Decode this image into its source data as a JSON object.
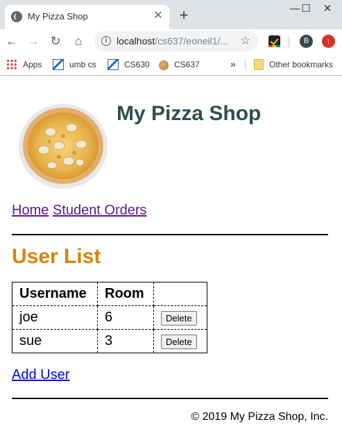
{
  "browser": {
    "tab_title": "My Pizza Shop",
    "tab_close": "✕",
    "new_tab": "+",
    "window_controls": {
      "minimize": "—",
      "maximize": "☐",
      "close": "✕"
    },
    "url_host": "localhost",
    "url_path": "/cs637/eoneil1/...",
    "avatar_letter": "B",
    "bookmarks": [
      "Apps",
      "umb cs",
      "CS630",
      "CS637"
    ],
    "other_bookmarks": "Other bookmarks",
    "overflow": "»"
  },
  "site": {
    "title": "My Pizza Shop",
    "nav": [
      "Home",
      "Student Orders"
    ]
  },
  "user_list": {
    "title": "User List",
    "columns": [
      "Username",
      "Room",
      ""
    ],
    "rows": [
      {
        "username": "joe",
        "room": "6",
        "action": "Delete"
      },
      {
        "username": "sue",
        "room": "3",
        "action": "Delete"
      }
    ],
    "add_link": "Add User"
  },
  "footer": "© 2019 My Pizza Shop, Inc.",
  "colors": {
    "site_title": "#2f4f4f",
    "section_title": "#d4860b",
    "visited_link": "#551a8b",
    "link": "#0000ee"
  }
}
